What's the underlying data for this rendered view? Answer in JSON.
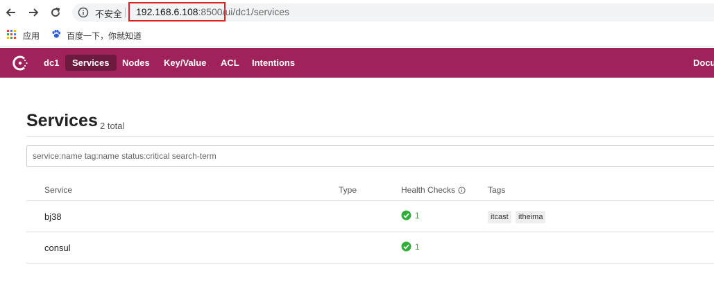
{
  "browser": {
    "security_label": "不安全",
    "url_host": "192.168.6.108",
    "url_port": ":8500",
    "url_path": "/ui/dc1/services",
    "bookmarks": [
      {
        "label": "应用",
        "icon": "apps-grid-icon"
      },
      {
        "label": "百度一下，你就知道",
        "icon": "baidu-paw-icon"
      }
    ]
  },
  "header": {
    "datacenter": "dc1",
    "nav": [
      "Services",
      "Nodes",
      "Key/Value",
      "ACL",
      "Intentions"
    ],
    "active": "Services",
    "right_link": "Docu",
    "brand_color": "#a0225a",
    "active_color": "#6c1a3f"
  },
  "page": {
    "title": "Services",
    "count": "2 total",
    "search_placeholder": "service:name tag:name status:critical search-term"
  },
  "table": {
    "columns": [
      "Service",
      "Type",
      "Health Checks",
      "Tags"
    ],
    "rows": [
      {
        "service": "bj38",
        "type": "",
        "health_checks": "1",
        "tags": [
          "itcast",
          "itheima"
        ]
      },
      {
        "service": "consul",
        "type": "",
        "health_checks": "1",
        "tags": []
      }
    ],
    "passing_color": "#2eb039"
  }
}
